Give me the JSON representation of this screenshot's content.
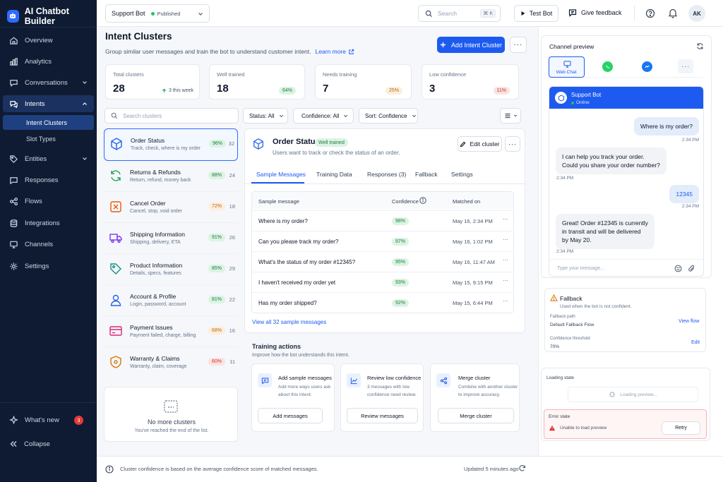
{
  "app": {
    "title": "AI Chatbot Builder"
  },
  "sidebar": {
    "items": [
      {
        "label": "Overview"
      },
      {
        "label": "Analytics"
      },
      {
        "label": "Conversations"
      },
      {
        "label": "Intents"
      },
      {
        "label": "Entities"
      },
      {
        "label": "Responses"
      },
      {
        "label": "Flows"
      },
      {
        "label": "Integrations"
      },
      {
        "label": "Channels"
      },
      {
        "label": "Settings"
      }
    ],
    "sub_items": [
      {
        "label": "Intent Clusters"
      },
      {
        "label": "Slot Types"
      }
    ],
    "whats_new": "What's new",
    "whats_new_count": "3",
    "collapse": "Collapse"
  },
  "topbar": {
    "bot_name": "Support Bot",
    "bot_status": "Published",
    "search_placeholder": "Search",
    "search_shortcut": "⌘ K",
    "test_bot": "Test Bot",
    "feedback": "Give feedback",
    "avatar": "AK"
  },
  "header": {
    "title": "Intent Clusters",
    "subtitle": "Group similar user messages and train the bot to understand customer intent.",
    "learn_more": "Learn more",
    "add_button": "Add Intent Cluster"
  },
  "stats": [
    {
      "label": "Total clusters",
      "value": "28",
      "delta": "3 this week"
    },
    {
      "label": "Well trained",
      "value": "18",
      "pct": "64%"
    },
    {
      "label": "Needs training",
      "value": "7",
      "pct": "25%"
    },
    {
      "label": "Low confidence",
      "value": "3",
      "pct": "11%"
    }
  ],
  "filters": {
    "search_placeholder": "Search clusters",
    "status": "Status: All",
    "confidence": "Confidence: All",
    "sort": "Sort: Confidence"
  },
  "clusters": [
    {
      "name": "Order Status",
      "desc": "Track, check, where is my order",
      "pct": "96%",
      "count": "32",
      "color": "#2563eb"
    },
    {
      "name": "Returns & Refunds",
      "desc": "Return, refund, money back",
      "pct": "88%",
      "count": "24",
      "color": "#16a34a"
    },
    {
      "name": "Cancel Order",
      "desc": "Cancel, stop, void order",
      "pct": "72%",
      "count": "18",
      "color": "#ea580c"
    },
    {
      "name": "Shipping Information",
      "desc": "Shipping, delivery, ETA",
      "pct": "91%",
      "count": "26",
      "color": "#7c3aed"
    },
    {
      "name": "Product Information",
      "desc": "Details, specs, features",
      "pct": "85%",
      "count": "29",
      "color": "#0d9488"
    },
    {
      "name": "Account & Profile",
      "desc": "Login, password, account",
      "pct": "81%",
      "count": "22",
      "color": "#2563eb"
    },
    {
      "name": "Payment Issues",
      "desc": "Payment failed, charge, billing",
      "pct": "68%",
      "count": "16",
      "color": "#db2777"
    },
    {
      "name": "Warranty & Claims",
      "desc": "Warranty, claim, coverage",
      "pct": "60%",
      "count": "11",
      "color": "#d97706"
    }
  ],
  "no_more": {
    "title": "No more clusters",
    "sub": "You've reached the end of the list."
  },
  "detail": {
    "title": "Order Status",
    "status": "Well trained",
    "desc": "Users want to track or check the status of an order.",
    "edit": "Edit cluster",
    "tabs": [
      "Sample Messages",
      "Training Data",
      "Responses (3)",
      "Fallback",
      "Settings"
    ],
    "columns": [
      "Sample message",
      "Confidence",
      "Matched on"
    ],
    "rows": [
      {
        "q": "Where is my order?",
        "c": "98%",
        "d": "May 16, 2:34 PM"
      },
      {
        "q": "Can you please track my order?",
        "c": "97%",
        "d": "May 16, 1:02 PM"
      },
      {
        "q": "What's the status of my order #12345?",
        "c": "95%",
        "d": "May 16, 11:47 AM"
      },
      {
        "q": "I haven't received my order yet",
        "c": "93%",
        "d": "May 15, 9:15 PM"
      },
      {
        "q": "Has my order shipped?",
        "c": "92%",
        "d": "May 15, 6:44 PM"
      }
    ],
    "view_all": "View all 32 sample messages"
  },
  "training": {
    "title": "Training actions",
    "sub": "Improve how the bot understands this intent.",
    "cards": [
      {
        "title": "Add sample messages",
        "desc1": "Add more ways users ask",
        "desc2": "about this intent.",
        "btn": "Add messages"
      },
      {
        "title": "Review low confidence",
        "desc1": "3 messages with low",
        "desc2": "confidence need review.",
        "btn": "Review messages"
      },
      {
        "title": "Merge cluster",
        "desc1": "Combine with another cluster",
        "desc2": "to improve accuracy.",
        "btn": "Merge cluster"
      }
    ]
  },
  "preview": {
    "title": "Channel preview",
    "web_chat": "Web Chat",
    "bot_name": "Support Bot",
    "online": "Online",
    "messages": [
      {
        "text1": "Where is my order?",
        "time": "2:34 PM"
      },
      {
        "text1": "I can help you track your order.",
        "text2": "Could you share your order number?",
        "time": "2:34 PM"
      },
      {
        "text1": "12345",
        "time": "2:34 PM"
      },
      {
        "text1": "Great! Order #12345 is currently",
        "text2": "in transit and will be delivered",
        "text3": "by May 20.",
        "time": "2:34 PM"
      }
    ],
    "input_placeholder": "Type your message...",
    "fallback": {
      "title": "Fallback",
      "desc": "Used when the bot is not confident.",
      "path_label": "Fallback path",
      "path_value": "Default Fallback Flow",
      "view_flow": "View flow",
      "threshold_label": "Confidence threshold",
      "threshold_value": "70%",
      "edit": "Edit"
    },
    "loading": {
      "title": "Loading state",
      "text": "Loading preview..."
    },
    "error": {
      "title": "Error state",
      "text": "Unable to load preview",
      "retry": "Retry"
    }
  },
  "footer": {
    "note": "Cluster confidence is based on the average confidence score of matched messages.",
    "updated": "Updated 5 minutes ago"
  }
}
